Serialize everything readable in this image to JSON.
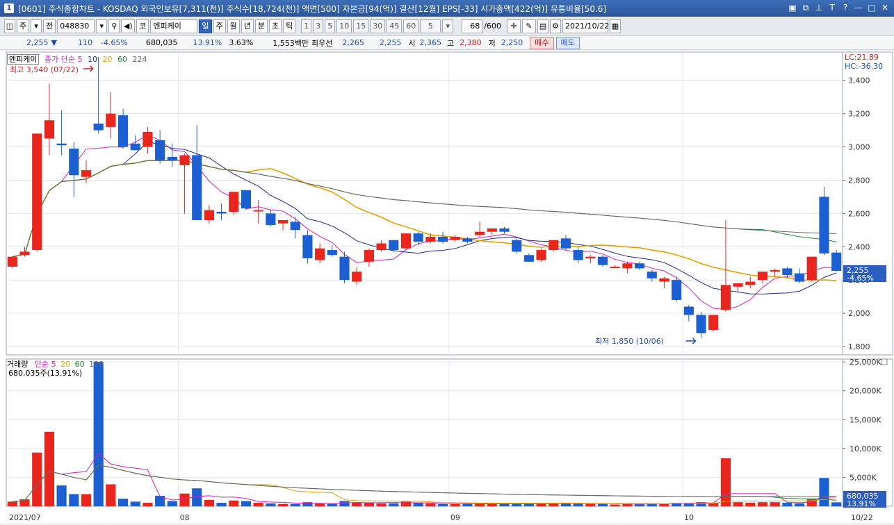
{
  "window": {
    "title": "[0601] 주식종합차트 - KOSDAQ 외국인보유[7,311(천)] 주식수[18,724(천)] 액면[500] 자본금[94(억)] 결산[12월] EPS[-33] 시가총액[422(억)] 유통비율[50.6]",
    "number": "1"
  },
  "toolbar": {
    "ju": "주",
    "jeon": "전",
    "code": "048830",
    "kospi": "코",
    "stock_name": "엔피케이",
    "periods": [
      "일",
      "주",
      "월",
      "년",
      "분",
      "초",
      "틱"
    ],
    "intervals": [
      "1",
      "3",
      "5",
      "10",
      "15",
      "30",
      "45",
      "60"
    ],
    "interval_value": "5",
    "count": "68",
    "count_total": "/600",
    "date": "2021/10/22"
  },
  "quote": {
    "price": "2,255",
    "arrow": "▼",
    "change": "110",
    "change_pct": "-4.65%",
    "volume": "680,035",
    "volume_pct": "13.91%",
    "turnover": "3.63%",
    "amount": "1,553백만",
    "best_label": "최우선",
    "best_ask": "2,265",
    "best_bid": "2,255",
    "open_label": "시",
    "open": "2,365",
    "high_label": "고",
    "high": "2,380",
    "low_label": "저",
    "low": "2,250",
    "buy": "매수",
    "sell": "매도"
  },
  "price_panel": {
    "stock_label": "엔피케이",
    "ma_label": "종가 단순",
    "ma_periods": [
      "5",
      "10",
      "20",
      "60",
      "224"
    ],
    "ma_colors": [
      "#d020c0",
      "#1a2a8a",
      "#e8a000",
      "#1a8a2a",
      "#666666"
    ],
    "high_annotation": "최고 3,540 (07/22)",
    "low_annotation": "최저 1,850 (10/06)",
    "lc": "LC:21.89",
    "hc": "HC:-36.30",
    "current_price_tag": "2,255",
    "current_pct_tag": "-4.65%",
    "y_ticks": [
      "3,400",
      "3,200",
      "3,000",
      "2,800",
      "2,600",
      "2,400",
      "2,200",
      "2,000",
      "1,800"
    ]
  },
  "volume_panel": {
    "label": "거래량",
    "ma_label": "단순",
    "ma_periods": [
      "5",
      "20",
      "60",
      "120"
    ],
    "ma_colors": [
      "#d020c0",
      "#e8a000",
      "#1a8a2a",
      "#666666"
    ],
    "current": "680,035주(13.91%)",
    "volume_tag": "680,035",
    "pct_tag": "13.91%",
    "y_ticks": [
      "25,000K",
      "20,000K",
      "15,000K",
      "10,000K",
      "5,000K"
    ]
  },
  "x_axis": {
    "labels": [
      "2021/07",
      "08",
      "09",
      "10",
      "10/22"
    ]
  },
  "chart_data": {
    "type": "candlestick",
    "ylim": [
      1750,
      3570
    ],
    "volume_ylim": [
      0,
      25500
    ],
    "candles": [
      {
        "o": 2280,
        "h": 2330,
        "l": 2270,
        "c": 2340,
        "v": 800
      },
      {
        "o": 2350,
        "h": 2400,
        "l": 2340,
        "c": 2370,
        "v": 1200
      },
      {
        "o": 2380,
        "h": 3080,
        "l": 2370,
        "c": 3080,
        "v": 9300
      },
      {
        "o": 3050,
        "h": 3380,
        "l": 2950,
        "c": 3160,
        "v": 12900
      },
      {
        "o": 3020,
        "h": 3220,
        "l": 2950,
        "c": 3010,
        "v": 3600
      },
      {
        "o": 2990,
        "h": 3030,
        "l": 2700,
        "c": 2830,
        "v": 2100
      },
      {
        "o": 2820,
        "h": 2920,
        "l": 2780,
        "c": 2860,
        "v": 2100
      },
      {
        "o": 3140,
        "h": 3540,
        "l": 3080,
        "c": 3100,
        "v": 25000
      },
      {
        "o": 3120,
        "h": 3330,
        "l": 3050,
        "c": 3200,
        "v": 3800
      },
      {
        "o": 3190,
        "h": 3230,
        "l": 2990,
        "c": 3000,
        "v": 1300
      },
      {
        "o": 3020,
        "h": 3070,
        "l": 2980,
        "c": 2980,
        "v": 800
      },
      {
        "o": 3000,
        "h": 3120,
        "l": 2960,
        "c": 3090,
        "v": 600
      },
      {
        "o": 3040,
        "h": 3100,
        "l": 2900,
        "c": 2920,
        "v": 1800
      },
      {
        "o": 2940,
        "h": 3020,
        "l": 2880,
        "c": 2920,
        "v": 900
      },
      {
        "o": 2890,
        "h": 2960,
        "l": 2600,
        "c": 2950,
        "v": 2200
      },
      {
        "o": 2950,
        "h": 3130,
        "l": 2560,
        "c": 2560,
        "v": 3100
      },
      {
        "o": 2560,
        "h": 2650,
        "l": 2540,
        "c": 2620,
        "v": 1100
      },
      {
        "o": 2610,
        "h": 2660,
        "l": 2560,
        "c": 2600,
        "v": 600
      },
      {
        "o": 2610,
        "h": 2730,
        "l": 2590,
        "c": 2730,
        "v": 1000
      },
      {
        "o": 2740,
        "h": 2740,
        "l": 2620,
        "c": 2630,
        "v": 900
      },
      {
        "o": 2620,
        "h": 2680,
        "l": 2540,
        "c": 2620,
        "v": 600
      },
      {
        "o": 2600,
        "h": 2620,
        "l": 2520,
        "c": 2530,
        "v": 500
      },
      {
        "o": 2540,
        "h": 2560,
        "l": 2500,
        "c": 2560,
        "v": 400
      },
      {
        "o": 2550,
        "h": 2580,
        "l": 2450,
        "c": 2500,
        "v": 400
      },
      {
        "o": 2470,
        "h": 2500,
        "l": 2300,
        "c": 2330,
        "v": 700
      },
      {
        "o": 2320,
        "h": 2420,
        "l": 2300,
        "c": 2390,
        "v": 500
      },
      {
        "o": 2380,
        "h": 2410,
        "l": 2340,
        "c": 2350,
        "v": 400
      },
      {
        "o": 2340,
        "h": 2370,
        "l": 2180,
        "c": 2200,
        "v": 900
      },
      {
        "o": 2190,
        "h": 2280,
        "l": 2170,
        "c": 2250,
        "v": 700
      },
      {
        "o": 2310,
        "h": 2390,
        "l": 2280,
        "c": 2380,
        "v": 600
      },
      {
        "o": 2380,
        "h": 2440,
        "l": 2370,
        "c": 2420,
        "v": 500
      },
      {
        "o": 2440,
        "h": 2440,
        "l": 2370,
        "c": 2380,
        "v": 500
      },
      {
        "o": 2390,
        "h": 2480,
        "l": 2380,
        "c": 2480,
        "v": 800
      },
      {
        "o": 2480,
        "h": 2490,
        "l": 2410,
        "c": 2430,
        "v": 600
      },
      {
        "o": 2430,
        "h": 2480,
        "l": 2420,
        "c": 2460,
        "v": 500
      },
      {
        "o": 2460,
        "h": 2490,
        "l": 2420,
        "c": 2430,
        "v": 400
      },
      {
        "o": 2440,
        "h": 2470,
        "l": 2430,
        "c": 2460,
        "v": 400
      },
      {
        "o": 2450,
        "h": 2460,
        "l": 2420,
        "c": 2430,
        "v": 400
      },
      {
        "o": 2470,
        "h": 2550,
        "l": 2460,
        "c": 2490,
        "v": 500
      },
      {
        "o": 2490,
        "h": 2510,
        "l": 2470,
        "c": 2510,
        "v": 400
      },
      {
        "o": 2510,
        "h": 2520,
        "l": 2480,
        "c": 2490,
        "v": 400
      },
      {
        "o": 2440,
        "h": 2450,
        "l": 2360,
        "c": 2370,
        "v": 500
      },
      {
        "o": 2350,
        "h": 2360,
        "l": 2310,
        "c": 2310,
        "v": 400
      },
      {
        "o": 2320,
        "h": 2390,
        "l": 2310,
        "c": 2380,
        "v": 500
      },
      {
        "o": 2380,
        "h": 2440,
        "l": 2370,
        "c": 2440,
        "v": 500
      },
      {
        "o": 2450,
        "h": 2470,
        "l": 2380,
        "c": 2390,
        "v": 600
      },
      {
        "o": 2380,
        "h": 2400,
        "l": 2300,
        "c": 2320,
        "v": 500
      },
      {
        "o": 2330,
        "h": 2350,
        "l": 2300,
        "c": 2340,
        "v": 400
      },
      {
        "o": 2340,
        "h": 2350,
        "l": 2280,
        "c": 2290,
        "v": 400
      },
      {
        "o": 2280,
        "h": 2290,
        "l": 2270,
        "c": 2280,
        "v": 300
      },
      {
        "o": 2270,
        "h": 2310,
        "l": 2240,
        "c": 2300,
        "v": 400
      },
      {
        "o": 2300,
        "h": 2310,
        "l": 2260,
        "c": 2270,
        "v": 400
      },
      {
        "o": 2250,
        "h": 2260,
        "l": 2190,
        "c": 2210,
        "v": 500
      },
      {
        "o": 2190,
        "h": 2220,
        "l": 2150,
        "c": 2210,
        "v": 400
      },
      {
        "o": 2200,
        "h": 2220,
        "l": 2070,
        "c": 2080,
        "v": 600
      },
      {
        "o": 2040,
        "h": 2050,
        "l": 1950,
        "c": 1990,
        "v": 600
      },
      {
        "o": 1990,
        "h": 2010,
        "l": 1850,
        "c": 1880,
        "v": 700
      },
      {
        "o": 1900,
        "h": 1990,
        "l": 1890,
        "c": 1990,
        "v": 600
      },
      {
        "o": 2020,
        "h": 2560,
        "l": 2010,
        "c": 2170,
        "v": 8300
      },
      {
        "o": 2160,
        "h": 2180,
        "l": 2130,
        "c": 2180,
        "v": 700
      },
      {
        "o": 2170,
        "h": 2220,
        "l": 2150,
        "c": 2190,
        "v": 600
      },
      {
        "o": 2200,
        "h": 2250,
        "l": 2180,
        "c": 2250,
        "v": 700
      },
      {
        "o": 2250,
        "h": 2270,
        "l": 2220,
        "c": 2260,
        "v": 700
      },
      {
        "o": 2270,
        "h": 2280,
        "l": 2210,
        "c": 2230,
        "v": 600
      },
      {
        "o": 2240,
        "h": 2270,
        "l": 2180,
        "c": 2190,
        "v": 500
      },
      {
        "o": 2200,
        "h": 2340,
        "l": 2190,
        "c": 2340,
        "v": 1200
      },
      {
        "o": 2700,
        "h": 2760,
        "l": 2350,
        "c": 2360,
        "v": 4900
      },
      {
        "o": 2365,
        "h": 2380,
        "l": 2250,
        "c": 2255,
        "v": 680
      }
    ]
  }
}
